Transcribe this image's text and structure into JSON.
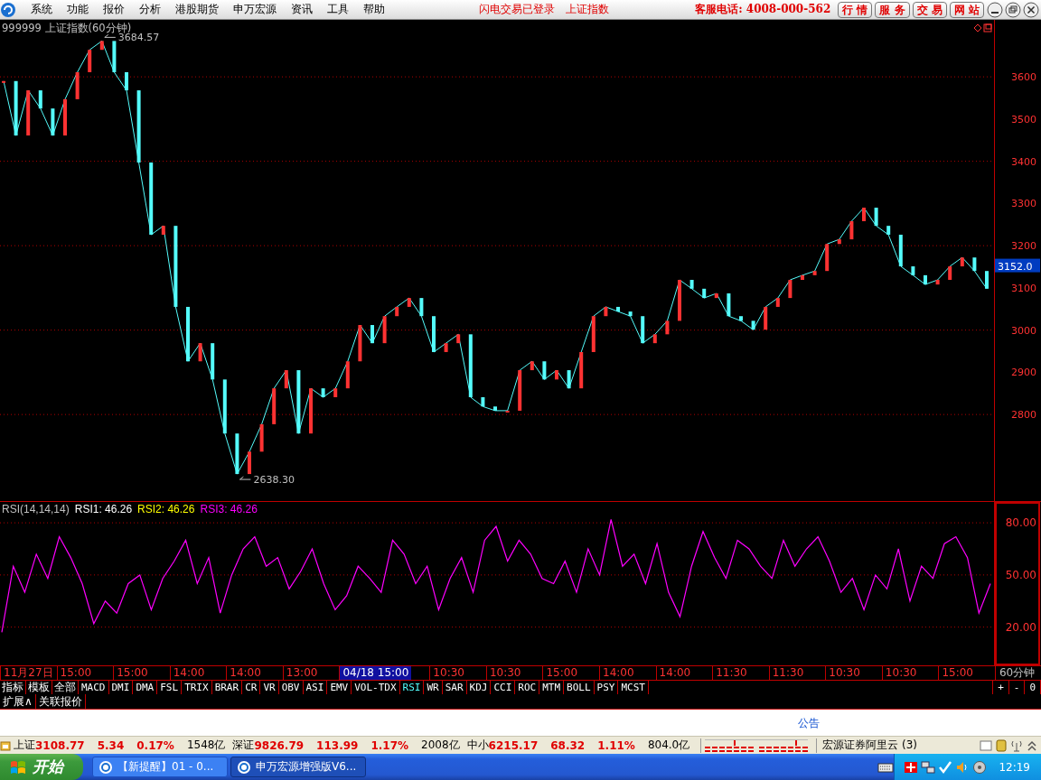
{
  "menu_bar": {
    "items": [
      "系统",
      "功能",
      "报价",
      "分析",
      "港股期货",
      "申万宏源",
      "资讯",
      "工具",
      "帮助"
    ],
    "notices": [
      "闪电交易已登录",
      "上证指数"
    ],
    "hotline": "客服电话: 4008-000-562",
    "buttons": [
      "行 情",
      "服 务",
      "交 易",
      "网 站"
    ]
  },
  "price_chart": {
    "current_price": "3152.0",
    "chart_data": {
      "type": "line",
      "title": "999999 上证指数(60分钟)",
      "ylim": [
        2595,
        3735
      ],
      "yticks": [
        2800,
        2900,
        3000,
        3100,
        3200,
        3300,
        3400,
        3500,
        3600
      ],
      "series": [
        {
          "color": "#54fcfc",
          "values": [
            3590,
            3461,
            3568,
            3525,
            3461,
            3547,
            3611,
            3664,
            3685,
            3611,
            3568,
            3397,
            3226,
            3247,
            3055,
            2926,
            2969,
            2883,
            2755,
            2659,
            2712,
            2777,
            2862,
            2905,
            2755,
            2862,
            2841,
            2862,
            2926,
            3012,
            2969,
            3033,
            3055,
            3076,
            3033,
            2948,
            2969,
            2990,
            2841,
            2819,
            2809,
            2809,
            2905,
            2926,
            2883,
            2905,
            2862,
            2948,
            3033,
            3055,
            3044,
            3033,
            2969,
            2990,
            3022,
            3119,
            3098,
            3076,
            3087,
            3033,
            3022,
            3001,
            3055,
            3076,
            3119,
            3130,
            3140,
            3204,
            3215,
            3258,
            3290,
            3247,
            3226,
            3151,
            3130,
            3108,
            3119,
            3151,
            3172,
            3140,
            3098
          ]
        }
      ],
      "grid": true,
      "annotations": [
        "3684.57",
        "2638.30"
      ]
    }
  },
  "rsi_chart": {
    "readings": [
      {
        "text": "RSI1: 46.26",
        "color": "#ffffff"
      },
      {
        "text": "RSI2: 46.26",
        "color": "#ffff00"
      },
      {
        "text": "RSI3: 46.26",
        "color": "#ff00ff"
      }
    ],
    "chart_data": {
      "type": "line",
      "title": "RSI(14,14,14)",
      "ylim": [
        -2,
        92
      ],
      "yticks": [
        {
          "value": 20,
          "label": "20.00"
        },
        {
          "value": 50,
          "label": "50.00"
        },
        {
          "value": 80,
          "label": "80.00"
        }
      ],
      "grid": true,
      "series": [
        {
          "color": "#ff00ff",
          "values": [
            17,
            55,
            40,
            62,
            48,
            72,
            60,
            45,
            22,
            35,
            28,
            45,
            50,
            30,
            48,
            58,
            70,
            45,
            60,
            28,
            50,
            65,
            72,
            55,
            60,
            42,
            52,
            65,
            45,
            30,
            38,
            55,
            48,
            40,
            70,
            62,
            45,
            55,
            30,
            48,
            60,
            40,
            70,
            78,
            58,
            70,
            62,
            48,
            45,
            58,
            40,
            65,
            50,
            82,
            55,
            62,
            45,
            68,
            40,
            26,
            55,
            75,
            60,
            48,
            70,
            65,
            55,
            48,
            70,
            55,
            65,
            72,
            58,
            40,
            48,
            30,
            50,
            42,
            65,
            35,
            55,
            48,
            68,
            72,
            60,
            28,
            45
          ]
        }
      ]
    }
  },
  "time_axis": {
    "labels": [
      {
        "text": "11月27日",
        "selected": false
      },
      {
        "text": "15:00",
        "selected": false
      },
      {
        "text": "15:00",
        "selected": false
      },
      {
        "text": "14:00",
        "selected": false
      },
      {
        "text": "14:00",
        "selected": false
      },
      {
        "text": "13:00",
        "selected": false
      },
      {
        "text": "04/18 15:00",
        "selected": true
      },
      {
        "text": "10:30",
        "selected": false
      },
      {
        "text": "10:30",
        "selected": false
      },
      {
        "text": "15:00",
        "selected": false
      },
      {
        "text": "14:00",
        "selected": false
      },
      {
        "text": "14:00",
        "selected": false
      },
      {
        "text": "11:30",
        "selected": false
      },
      {
        "text": "11:30",
        "selected": false
      },
      {
        "text": "10:30",
        "selected": false
      },
      {
        "text": "10:30",
        "selected": false
      },
      {
        "text": "15:00",
        "selected": false
      }
    ],
    "period": "60分钟"
  },
  "indicator_bar": {
    "groups": [
      "指标",
      "模板",
      "全部"
    ],
    "tabs": [
      {
        "label": "MACD",
        "selected": false
      },
      {
        "label": "DMI",
        "selected": false
      },
      {
        "label": "DMA",
        "selected": false
      },
      {
        "label": "FSL",
        "selected": false
      },
      {
        "label": "TRIX",
        "selected": false
      },
      {
        "label": "BRAR",
        "selected": false
      },
      {
        "label": "CR",
        "selected": false
      },
      {
        "label": "VR",
        "selected": false
      },
      {
        "label": "OBV",
        "selected": false
      },
      {
        "label": "ASI",
        "selected": false
      },
      {
        "label": "EMV",
        "selected": false
      },
      {
        "label": "VOL-TDX",
        "selected": false
      },
      {
        "label": "RSI",
        "selected": true
      },
      {
        "label": "WR",
        "selected": false
      },
      {
        "label": "SAR",
        "selected": false
      },
      {
        "label": "KDJ",
        "selected": false
      },
      {
        "label": "CCI",
        "selected": false
      },
      {
        "label": "ROC",
        "selected": false
      },
      {
        "label": "MTM",
        "selected": false
      },
      {
        "label": "BOLL",
        "selected": false
      },
      {
        "label": "PSY",
        "selected": false
      },
      {
        "label": "MCST",
        "selected": false
      }
    ],
    "zoom_buttons": [
      "+",
      "-",
      "0"
    ]
  },
  "extra_tabs": [
    "扩展∧",
    "关联报价"
  ],
  "notice": "公告",
  "quote_bar": {
    "indexes": [
      {
        "name": "上证",
        "price": "3108.77",
        "change": "5.34",
        "percent": "0.17%",
        "amount": "1548亿"
      },
      {
        "name": "深证",
        "price": "9826.79",
        "change": "113.99",
        "percent": "1.17%",
        "amount": "2008亿"
      },
      {
        "name": "中小",
        "price": "6215.17",
        "change": "68.32",
        "percent": "1.11%",
        "amount": "804.0亿"
      }
    ],
    "server": "宏源证券阿里云 (3)"
  },
  "taskbar": {
    "start": "开始",
    "tasks": [
      {
        "label": "【新提醒】01 - 0...",
        "selected": false
      },
      {
        "label": "申万宏源增强版V6...",
        "selected": true
      }
    ],
    "clock": "12:19"
  }
}
